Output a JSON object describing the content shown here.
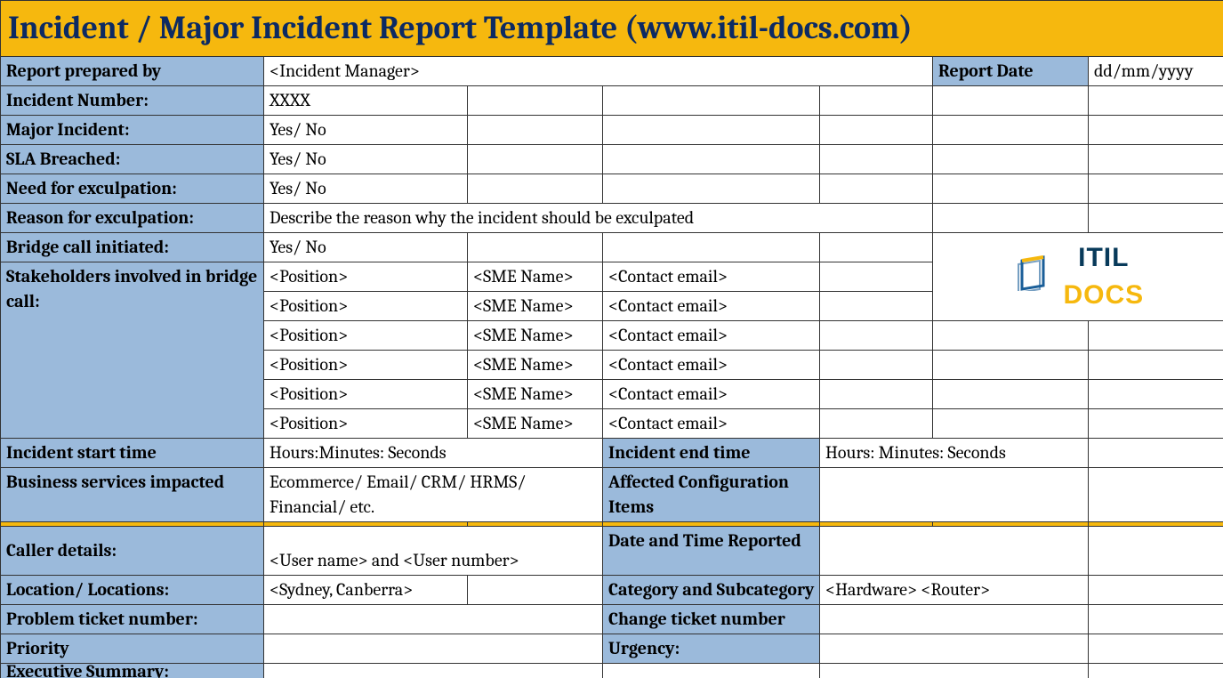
{
  "title": "Incident / Major Incident Report Template   (www.itil-docs.com)",
  "rows": {
    "report_prepared_by": {
      "label": "Report prepared by",
      "value": "<Incident Manager>"
    },
    "report_date": {
      "label": "Report Date",
      "value": "dd/mm/yyyy"
    },
    "incident_number": {
      "label": "Incident Number:",
      "value": "XXXX"
    },
    "major_incident": {
      "label": "Major Incident:",
      "value": "Yes/ No"
    },
    "sla_breached": {
      "label": "SLA Breached:",
      "value": "Yes/ No"
    },
    "need_exculpation": {
      "label": "Need for exculpation:",
      "value": "Yes/ No"
    },
    "reason_exculpation": {
      "label": "Reason for exculpation:",
      "value": "Describe the reason why the incident should be exculpated"
    },
    "bridge_call": {
      "label": "Bridge call initiated:",
      "value": "Yes/ No"
    },
    "stakeholders_label": "Stakeholders involved in bridge call:",
    "stakeholders": [
      {
        "position": "<Position>",
        "sme": "<SME Name>",
        "email": "<Contact email>"
      },
      {
        "position": "<Position>",
        "sme": "<SME Name>",
        "email": "<Contact email>"
      },
      {
        "position": "<Position>",
        "sme": "<SME Name>",
        "email": "<Contact email>"
      },
      {
        "position": "<Position>",
        "sme": "<SME Name>",
        "email": "<Contact email>"
      },
      {
        "position": "<Position>",
        "sme": "<SME Name>",
        "email": "<Contact email>"
      },
      {
        "position": "<Position>",
        "sme": "<SME Name>",
        "email": "<Contact email>"
      }
    ],
    "incident_start": {
      "label": "Incident start time",
      "value": "Hours:Minutes: Seconds"
    },
    "incident_end": {
      "label": "Incident end time",
      "value": "Hours: Minutes: Seconds"
    },
    "business_services": {
      "label": "Business services impacted",
      "value": "Ecommerce/ Email/ CRM/ HRMS/ Financial/ etc."
    },
    "affected_ci": {
      "label": "Affected Configuration Items"
    },
    "caller_details": {
      "label": "Caller details:",
      "value": "<User name> and <User number>"
    },
    "date_time_reported": {
      "label": "Date and Time Reported"
    },
    "location": {
      "label": "Location/ Locations:",
      "value": "<Sydney, Canberra>"
    },
    "category": {
      "label": "Category and Subcategory",
      "value": "<Hardware> <Router>"
    },
    "problem_ticket": {
      "label": "Problem ticket number:"
    },
    "change_ticket": {
      "label": "Change ticket number"
    },
    "priority": {
      "label": "Priority"
    },
    "urgency": {
      "label": "Urgency:"
    },
    "executive_summary": {
      "label": "Executive Summary:"
    }
  },
  "logo": {
    "itil": "ITIL",
    "docs": "DOCS"
  }
}
